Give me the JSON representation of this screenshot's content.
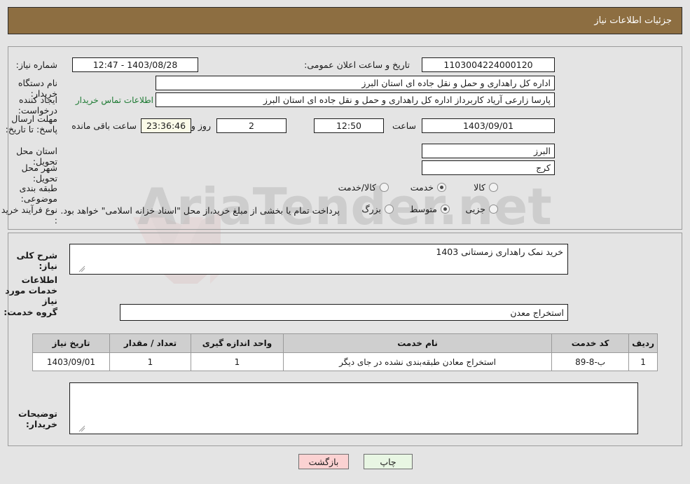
{
  "header": {
    "title": "جزئیات اطلاعات نیاز"
  },
  "top": {
    "need_number_label": "شماره نیاز:",
    "need_number_value": "1103004224000120",
    "announce_label": "تاریخ و ساعت اعلان عمومی:",
    "announce_value": "1403/08/28 - 12:47",
    "buyer_org_label": "نام دستگاه خریدار:",
    "buyer_org_value": "اداره کل راهداری و حمل و نقل جاده ای استان البرز",
    "requester_label": "ایجاد کننده درخواست:",
    "requester_value": "پارسا زارعی آریاد کاربرداز اداره کل راهداری و حمل و نقل جاده ای استان البرز",
    "contact_link": "اطلاعات تماس خریدار",
    "deadline_label": "مهلت ارسال پاسخ: تا تاریخ:",
    "deadline_date": "1403/09/01",
    "hour_label": "ساعت",
    "deadline_time": "12:50",
    "remaining_days": "2",
    "remaining_days_label": "روز و",
    "remaining_timer": "23:36:46",
    "remaining_hours_label": "ساعت باقی مانده",
    "province_label": "استان محل تحویل:",
    "province_value": "البرز",
    "city_label": "شهر محل تحویل:",
    "city_value": "کرج",
    "category_label": "طبقه بندی موضوعی:",
    "category_options": [
      "کالا",
      "خدمت",
      "کالا/خدمت"
    ],
    "category_selected": "خدمت",
    "process_label": "نوع فرآیند خرید :",
    "process_options": [
      "جزیی",
      "متوسط",
      "بزرگ"
    ],
    "process_selected": "متوسط",
    "treasury_note": "پرداخت تمام یا بخشی از مبلغ خرید،از محل \"اسناد خزانه اسلامی\" خواهد بود."
  },
  "mid": {
    "summary_label": "شرح کلی نیاز:",
    "summary_value": "خرید نمک راهداری زمستانی 1403",
    "services_title": "اطلاعات خدمات مورد نیاز",
    "service_group_label": "گروه خدمت:",
    "service_group_value": "استخراج معدن",
    "buyer_notes_label": "توضیحات خریدار:",
    "buyer_notes_value": ""
  },
  "table": {
    "columns": [
      "ردیف",
      "کد خدمت",
      "نام خدمت",
      "واحد اندازه گیری",
      "تعداد / مقدار",
      "تاریخ نیاز"
    ],
    "rows": [
      {
        "row": "1",
        "service_code": "ب-8-89",
        "service_name": "استخراج معادن طبقه‌بندی نشده در جای دیگر",
        "unit": "1",
        "quantity": "1",
        "need_date": "1403/09/01"
      }
    ]
  },
  "footer": {
    "print_label": "چاپ",
    "back_label": "بازگشت"
  },
  "watermark": {
    "text": "AriaTender.net"
  },
  "colors": {
    "header_bar": "#8d6e41",
    "link_green": "#1d7a33",
    "print_button": "#e8f6e3",
    "back_button": "#fbd2d2",
    "timer_field": "#fbfbe8",
    "page_background": "#e4e4e4"
  }
}
